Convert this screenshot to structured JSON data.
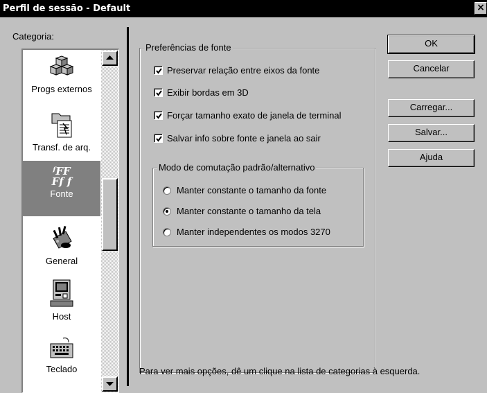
{
  "window": {
    "title": "Perfil de sessão - Default",
    "close_glyph": "×"
  },
  "sidebar": {
    "label": "Categoria:",
    "items": [
      {
        "label": "Progs externos",
        "icon": "external-programs-icon"
      },
      {
        "label": "Transf. de arq.",
        "icon": "file-transfer-icon"
      },
      {
        "label": "Fonte",
        "icon": "font-icon",
        "glyph_top": "ᶠFF",
        "glyph_bottom": "Ff f"
      },
      {
        "label": "General",
        "icon": "general-tools-icon"
      },
      {
        "label": "Host",
        "icon": "host-computer-icon"
      },
      {
        "label": "Teclado",
        "icon": "keyboard-icon"
      }
    ],
    "selected": "Fonte"
  },
  "font_prefs": {
    "title": "Preferências de fonte",
    "checkboxes": [
      {
        "label": "Preservar relação entre eixos da fonte",
        "checked": true
      },
      {
        "label": "Exibir bordas em 3D",
        "checked": true
      },
      {
        "label": "Forçar tamanho exato de janela de terminal",
        "checked": true
      },
      {
        "label": "Salvar info sobre fonte e janela ao sair",
        "checked": true
      }
    ],
    "mode_group": {
      "title": "Modo de comutação padrão/alternativo",
      "options": [
        {
          "label": "Manter constante o tamanho da fonte",
          "selected": false
        },
        {
          "label": "Manter constante o tamanho da tela",
          "selected": true
        },
        {
          "label": "Manter independentes os modos 3270",
          "selected": false
        }
      ]
    }
  },
  "buttons": {
    "ok": "OK",
    "cancel": "Cancelar",
    "load": "Carregar...",
    "save": "Salvar...",
    "help": "Ajuda"
  },
  "hint": "Para ver mais opções, dê um clique na lista de categorias à esquerda.",
  "colors": {
    "titlebar": "#000000",
    "face": "#c0c0c0",
    "selection": "#808080"
  }
}
